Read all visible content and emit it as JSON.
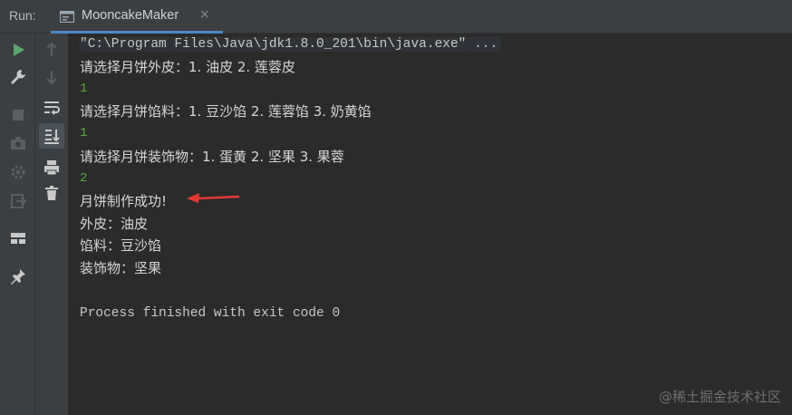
{
  "toolbar": {
    "run_label": "Run:",
    "tab_title": "MooncakeMaker",
    "tab_close": "×"
  },
  "gutter_icons": {
    "left": [
      "run-icon",
      "wrench-icon",
      "stop-icon",
      "camera-icon",
      "settings-gear-icon",
      "exit-icon",
      "layout-icon",
      "pin-icon"
    ],
    "right": [
      "up-arrow-icon",
      "down-arrow-icon",
      "soft-wrap-icon",
      "scroll-to-end-icon",
      "print-icon",
      "trash-icon"
    ]
  },
  "console": {
    "command": "\"C:\\Program Files\\Java\\jdk1.8.0_201\\bin\\java.exe\" ...",
    "lines": [
      {
        "kind": "cn",
        "text": "请选择月饼外皮：1. 油皮 2. 莲蓉皮"
      },
      {
        "kind": "input",
        "text": "1"
      },
      {
        "kind": "cn",
        "text": "请选择月饼馅料：1. 豆沙馅 2. 莲蓉馅 3. 奶黄馅"
      },
      {
        "kind": "input",
        "text": "1"
      },
      {
        "kind": "cn",
        "text": "请选择月饼装饰物：1. 蛋黄 2. 坚果 3. 果蓉"
      },
      {
        "kind": "input",
        "text": "2"
      },
      {
        "kind": "cn",
        "text": "月饼制作成功!"
      },
      {
        "kind": "cn",
        "text": "外皮：油皮"
      },
      {
        "kind": "cn",
        "text": "馅料：豆沙馅"
      },
      {
        "kind": "cn",
        "text": "装饰物：坚果"
      },
      {
        "kind": "mono",
        "text": "Process finished with exit code 0"
      }
    ]
  },
  "annotation": {
    "arrow_color": "#e53935"
  },
  "watermark": "@稀土掘金技术社区",
  "colors": {
    "bg": "#2b2b2b",
    "panel": "#3c3f41",
    "input_green": "#5aa83d",
    "tab_underline": "#4a88c7",
    "run_green": "#59a869"
  }
}
